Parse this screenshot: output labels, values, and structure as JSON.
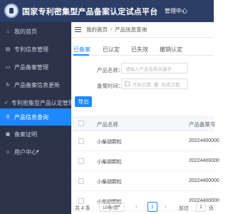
{
  "header": {
    "title": "国家专利密集型产品备案认定试点平台",
    "user_center": "管理中心",
    "logo_icon": "emblem-icon"
  },
  "sidebar": {
    "items": [
      {
        "label": "我的首页",
        "icon": "home-icon"
      },
      {
        "label": "专利信息管理",
        "icon": "document-icon"
      },
      {
        "label": "产品备案管理",
        "icon": "folder-icon"
      },
      {
        "label": "产品备案信息更新",
        "icon": "refresh-icon"
      },
      {
        "label": "专利密集型产品认定管理",
        "icon": "check-icon"
      },
      {
        "label": "产品信息查询",
        "icon": "search-icon"
      },
      {
        "label": "备案证明",
        "icon": "certificate-icon"
      },
      {
        "label": "用户中心",
        "icon": "user-icon"
      }
    ],
    "active_index": 5,
    "active_color": "#1e88ff"
  },
  "breadcrumb": {
    "home": "我的首页",
    "separator": "/",
    "current": "产品信息查询"
  },
  "tabs": [
    "已备案",
    "已认定",
    "已失效",
    "撤销认定"
  ],
  "active_tab": 0,
  "filters": {
    "product_name_label": "产品名称：",
    "product_name_placeholder": "请输入产品名称关键字",
    "filing_date_label": "备案时间：",
    "start_date_placeholder": "开始日期",
    "date_separator": "至",
    "end_date_placeholder": "结束日期"
  },
  "export_button": "导出",
  "table": {
    "columns": [
      "产品名称",
      "产品备案号"
    ],
    "rows": [
      {
        "name": "小柴胡颗粒",
        "filing_no": "20224400000"
      },
      {
        "name": "小柴胡颗粒",
        "filing_no": "20224400000"
      },
      {
        "name": "小柴胡颗粒",
        "filing_no": "20224400000"
      },
      {
        "name": "小柴胡颗粒",
        "filing_no": "20224400000"
      }
    ]
  },
  "pagination": {
    "total": "共 4 条",
    "page_size": "10条/页",
    "current_page": "1",
    "goto_label": "前往",
    "goto_value": "1",
    "page_suffix": "页"
  }
}
